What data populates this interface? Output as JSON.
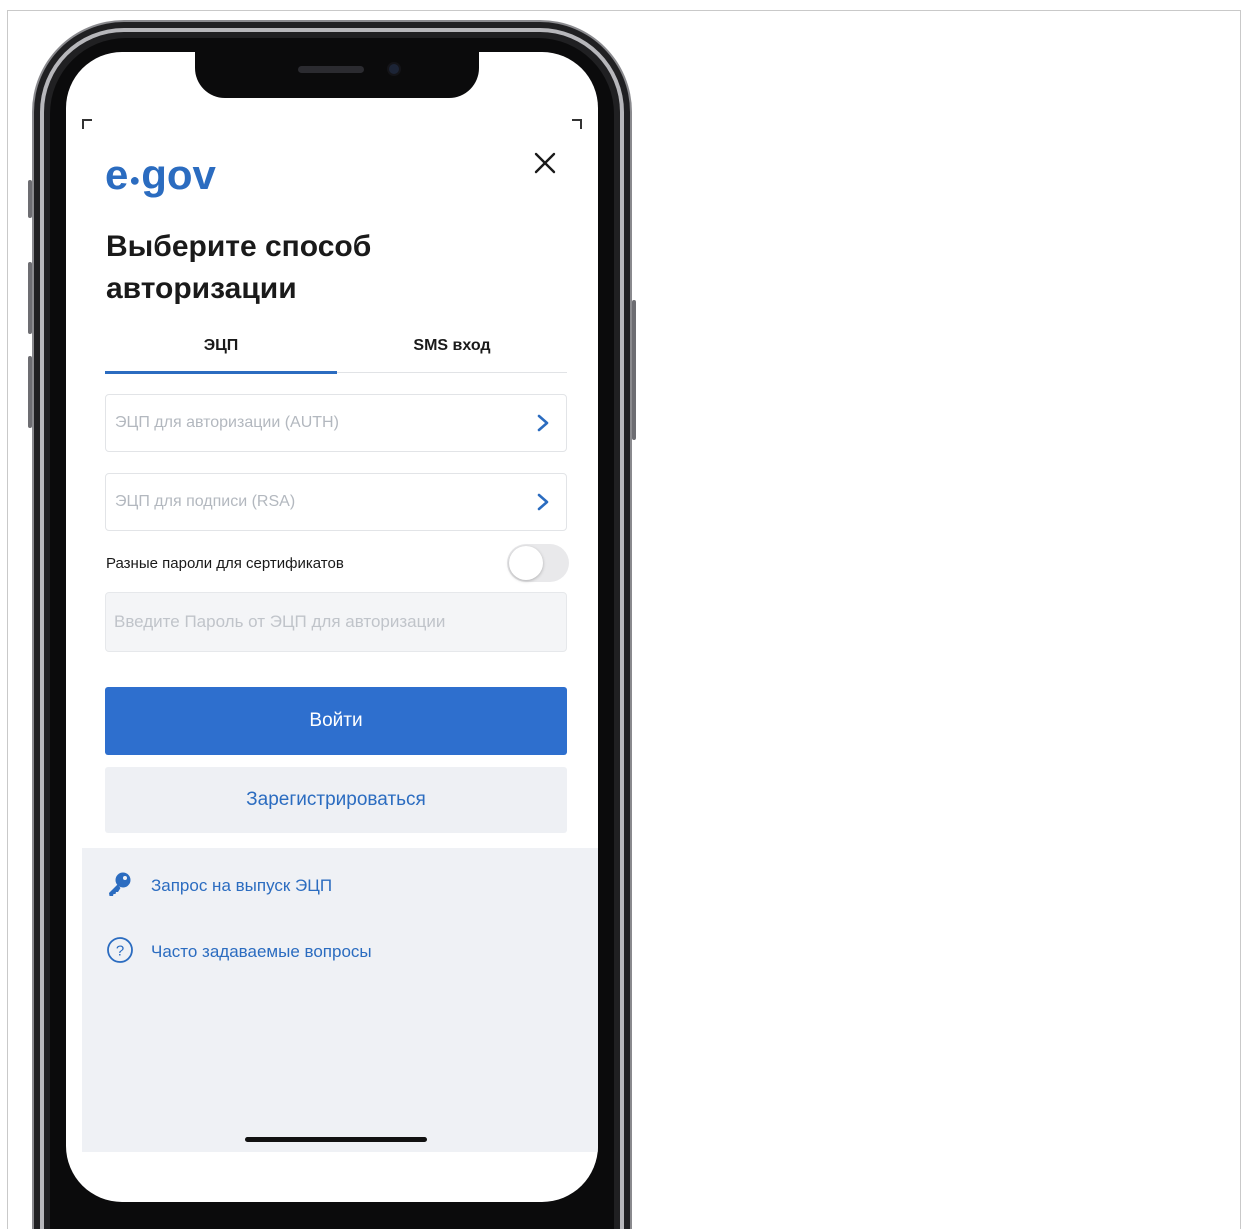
{
  "app": {
    "logo_text_left": "e",
    "logo_text_right": "gov"
  },
  "screen": {
    "title": "Выберите способ авторизации",
    "tabs": [
      {
        "label": "ЭЦП",
        "active": true
      },
      {
        "label": "SMS вход",
        "active": false
      }
    ],
    "fields": {
      "auth_cert_placeholder": "ЭЦП для авторизации (AUTH)",
      "rsa_cert_placeholder": "ЭЦП для подписи (RSA)",
      "different_passwords_label": "Разные пароли для сертификатов",
      "different_passwords_enabled": false,
      "password_placeholder": "Введите Пароль от ЭЦП для авторизации",
      "password_value": ""
    },
    "buttons": {
      "login": "Войти",
      "register": "Зарегистрироваться"
    },
    "links": [
      {
        "label": "Запрос на выпуск ЭЦП",
        "icon": "key-icon"
      },
      {
        "label": "Часто задаваемые вопросы",
        "icon": "question-circle-icon"
      }
    ]
  },
  "colors": {
    "brand_blue": "#2b6cc0",
    "primary_button": "#2e6fce",
    "secondary_button_bg": "#eef0f4",
    "placeholder_gray": "#b3b8bf",
    "panel_bg": "#eff1f5"
  }
}
